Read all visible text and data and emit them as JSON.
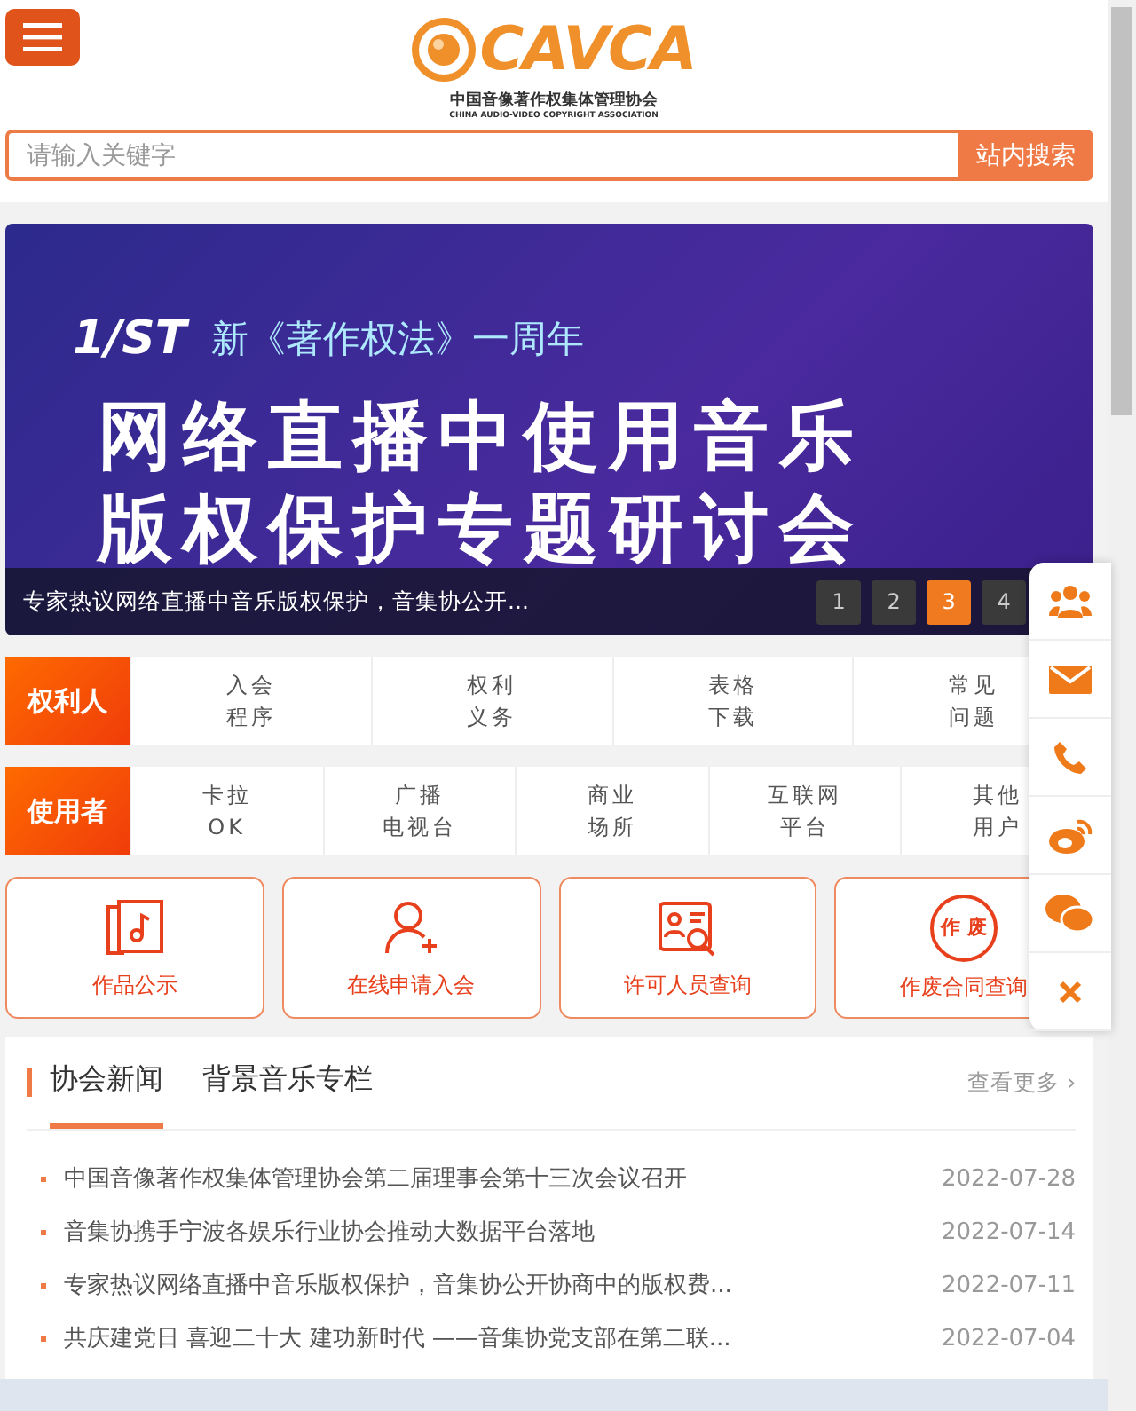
{
  "header": {
    "logo": {
      "mark": "CAVCA",
      "name_cn": "中国音像著作权集体管理协会",
      "name_en": "CHINA AUDIO-VIDEO COPYRIGHT ASSOCIATION"
    }
  },
  "search": {
    "placeholder": "请输入关键字",
    "button": "站内搜索"
  },
  "banner": {
    "badge": "1/ST",
    "subtitle": "新《著作权法》一周年",
    "headline": [
      "网络直播中使用音乐",
      "版权保护专题研讨会"
    ],
    "caption": "专家热议网络直播中音乐版权保护，音集协公开...",
    "dots": [
      {
        "label": "1",
        "selected": false
      },
      {
        "label": "2",
        "selected": false
      },
      {
        "label": "3",
        "selected": true
      },
      {
        "label": "4",
        "selected": false
      }
    ]
  },
  "nav_rows": [
    {
      "title": "权利人",
      "items": [
        [
          "入会",
          "程序"
        ],
        [
          "权利",
          "义务"
        ],
        [
          "表格",
          "下载"
        ],
        [
          "常见",
          "问题"
        ]
      ]
    },
    {
      "title": "使用者",
      "items": [
        [
          "卡拉",
          "OK"
        ],
        [
          "广播",
          "电视台"
        ],
        [
          "商业",
          "场所"
        ],
        [
          "互联网",
          "平台"
        ],
        [
          "其他",
          "用户"
        ]
      ]
    }
  ],
  "services": [
    {
      "kind": "music",
      "label": "作品公示"
    },
    {
      "kind": "adduser",
      "label": "在线申请入会"
    },
    {
      "kind": "idsearch",
      "label": "许可人员查询"
    },
    {
      "kind": "stamp",
      "label": "作废合同查询",
      "stamp": [
        "作",
        "废"
      ]
    }
  ],
  "side": [
    {
      "kind": "group"
    },
    {
      "kind": "mail"
    },
    {
      "kind": "phone"
    },
    {
      "kind": "weibo"
    },
    {
      "kind": "wechat"
    },
    {
      "kind": "close"
    }
  ],
  "news": {
    "tabs": [
      {
        "label": "协会新闻",
        "selected": true
      },
      {
        "label": "背景音乐专栏",
        "selected": false
      }
    ],
    "more": "查看更多 ›",
    "items": [
      {
        "title": "中国音像著作权集体管理协会第二届理事会第十三次会议召开",
        "date": "2022-07-28"
      },
      {
        "title": "音集协携手宁波各娱乐行业协会推动大数据平台落地",
        "date": "2022-07-14"
      },
      {
        "title": "专家热议网络直播中音乐版权保护，音集协公开协商中的版权费...",
        "date": "2022-07-11"
      },
      {
        "title": "共庆建党日 喜迎二十大 建功新时代 ——音集协党支部在第二联...",
        "date": "2022-07-04"
      }
    ]
  }
}
